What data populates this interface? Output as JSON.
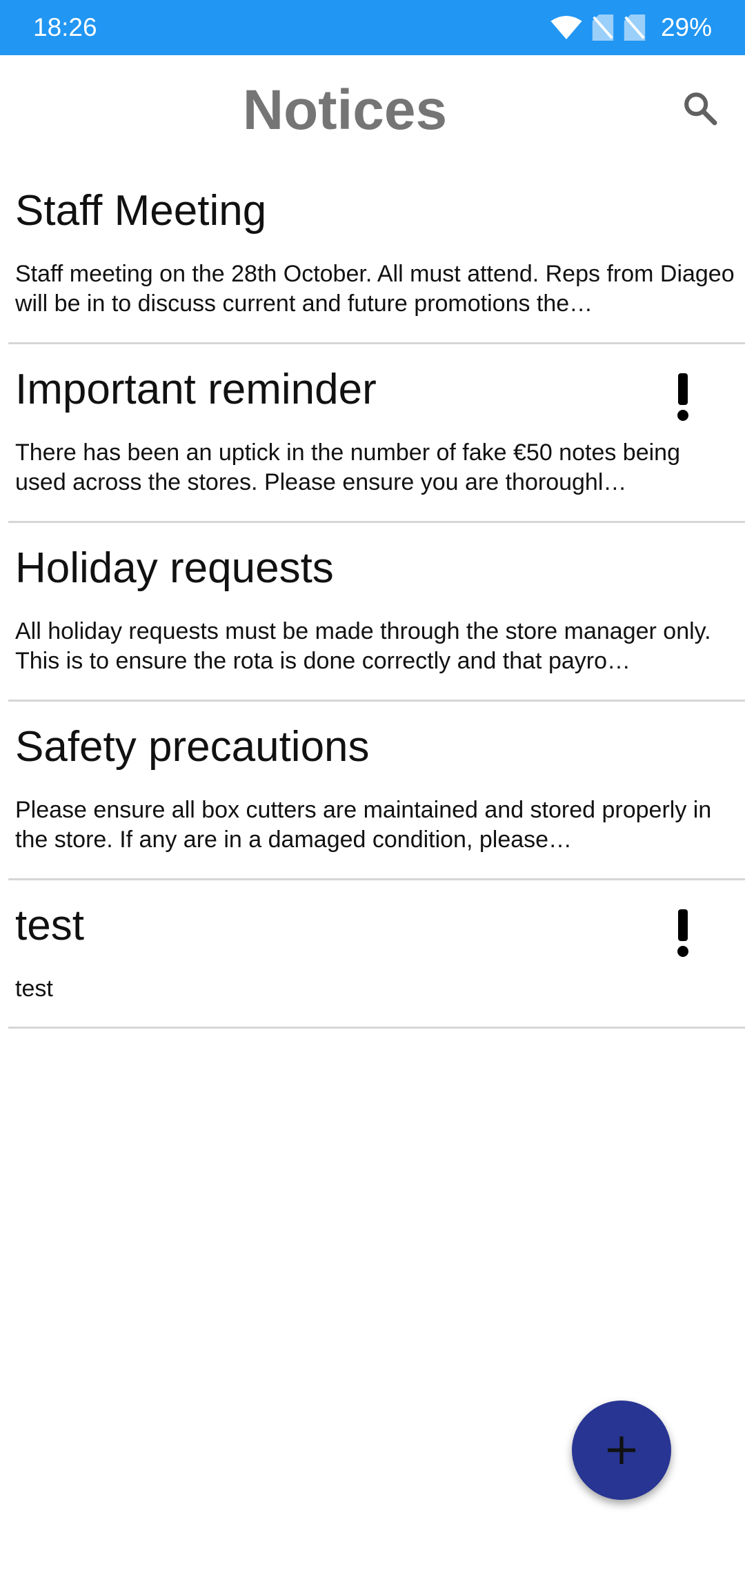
{
  "status": {
    "time": "18:26",
    "battery": "29%",
    "icons": [
      "wifi-icon",
      "no-sim-icon",
      "no-sim-icon"
    ]
  },
  "header": {
    "title": "Notices",
    "search_icon": "search-icon"
  },
  "notices": [
    {
      "title": "Staff Meeting",
      "body": "Staff meeting on the 28th October. All must attend. Reps from Diageo will be in to discuss current and future promotions the…",
      "important": false
    },
    {
      "title": "Important reminder",
      "body": "There has been an uptick in the number of fake €50 notes being used across the stores. Please ensure you are thoroughl…",
      "important": true
    },
    {
      "title": "Holiday requests",
      "body": "All holiday requests must be made through the store manager only. This is to ensure the rota is done correctly and that payro…",
      "important": false
    },
    {
      "title": "Safety precautions",
      "body": "Please ensure all box cutters are maintained and stored properly in the store. If any are in a damaged condition, please…",
      "important": false
    },
    {
      "title": "test",
      "body": "test",
      "important": true
    }
  ],
  "fab": {
    "icon": "plus-icon"
  },
  "colors": {
    "statusbar": "#2196F3",
    "fab": "#283593",
    "title": "#757575"
  }
}
